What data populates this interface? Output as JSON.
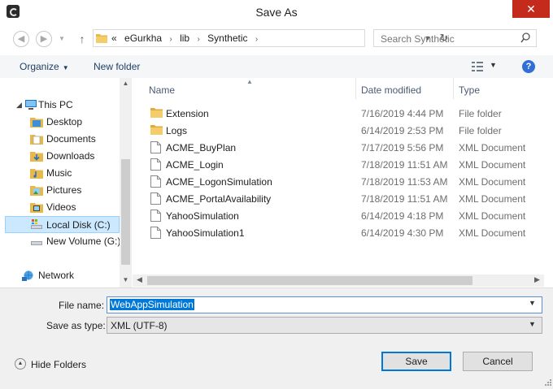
{
  "window": {
    "title": "Save As",
    "close_glyph": "✕"
  },
  "address_bar": {
    "overflow": "«",
    "crumbs": [
      "eGurkha",
      "lib",
      "Synthetic"
    ],
    "separator": "›"
  },
  "search": {
    "placeholder": "Search Synthetic"
  },
  "toolbar": {
    "organize_label": "Organize",
    "new_folder_label": "New folder"
  },
  "nav_pane": {
    "items": [
      {
        "label": "This PC",
        "icon": "computer-icon"
      },
      {
        "label": "Desktop",
        "icon": "folder-icon"
      },
      {
        "label": "Documents",
        "icon": "folder-icon"
      },
      {
        "label": "Downloads",
        "icon": "folder-icon"
      },
      {
        "label": "Music",
        "icon": "folder-icon"
      },
      {
        "label": "Pictures",
        "icon": "folder-icon"
      },
      {
        "label": "Videos",
        "icon": "folder-icon"
      },
      {
        "label": "Local Disk (C:)",
        "icon": "drive-icon",
        "selected": true
      },
      {
        "label": "New Volume (G:)",
        "icon": "drive-icon"
      },
      {
        "label": "Network",
        "icon": "network-icon"
      }
    ]
  },
  "file_list": {
    "columns": [
      "Name",
      "Date modified",
      "Type"
    ],
    "rows": [
      {
        "name": "Extension",
        "date": "7/16/2019 4:44 PM",
        "type": "File folder",
        "icon": "folder-icon"
      },
      {
        "name": "Logs",
        "date": "6/14/2019 2:53 PM",
        "type": "File folder",
        "icon": "folder-icon"
      },
      {
        "name": "ACME_BuyPlan",
        "date": "7/17/2019 5:56 PM",
        "type": "XML Document",
        "icon": "document-icon"
      },
      {
        "name": "ACME_Login",
        "date": "7/18/2019 11:51 AM",
        "type": "XML Document",
        "icon": "document-icon"
      },
      {
        "name": "ACME_LogonSimulation",
        "date": "7/18/2019 11:53 AM",
        "type": "XML Document",
        "icon": "document-icon"
      },
      {
        "name": "ACME_PortalAvailability",
        "date": "7/18/2019 11:51 AM",
        "type": "XML Document",
        "icon": "document-icon"
      },
      {
        "name": "YahooSimulation",
        "date": "6/14/2019 4:18 PM",
        "type": "XML Document",
        "icon": "document-icon"
      },
      {
        "name": "YahooSimulation1",
        "date": "6/14/2019 4:30 PM",
        "type": "XML Document",
        "icon": "document-icon"
      }
    ]
  },
  "form": {
    "filename_label": "File name:",
    "filename_value": "WebAppSimulation",
    "savetype_label": "Save as type:",
    "savetype_value": "XML (UTF-8)"
  },
  "footer": {
    "hide_folders_label": "Hide Folders",
    "save_label": "Save",
    "cancel_label": "Cancel"
  },
  "colors": {
    "accent": "#0078d7",
    "close": "#c42b1c",
    "selection": "#cce8ff",
    "folder": "#e8b84a"
  }
}
